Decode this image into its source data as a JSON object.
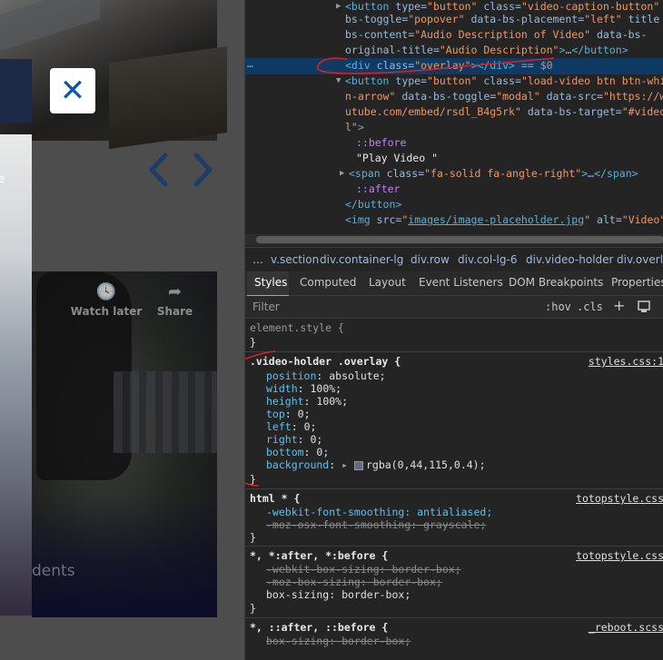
{
  "page": {
    "close_icon": "close-icon",
    "close_symbol": "✕",
    "prev_icon": "chevron-left-icon",
    "next_icon": "chevron-right-icon",
    "left_photo_label": "e",
    "watch_later_label": "Watch later",
    "share_label": "Share",
    "students_text": "dents"
  },
  "elements": {
    "lines": [
      {
        "prefix": "▶",
        "html": "<span class=\"tag\">&lt;button</span> <span class=\"attr\">type</span>=<span class=\"val\">\"button\"</span> <span class=\"attr\">class</span>=<span class=\"val\">\"video-caption-button\"</span> <span class=\"attr\">da</span>"
      },
      {
        "html": "<span class=\"attr\">bs-toggle</span>=<span class=\"val\">\"popover\"</span> <span class=\"attr\">data-bs-placement</span>=<span class=\"val\">\"left\"</span> <span class=\"attr\">title</span> <span class=\"attr\">da</span>"
      },
      {
        "html": "<span class=\"attr\">bs-content</span>=<span class=\"val\">\"Audio Description of Video\"</span> <span class=\"attr\">data-bs-</span>"
      },
      {
        "html": "<span class=\"attr\">original-title</span>=<span class=\"val\">\"Audio Description\"</span><span class=\"tag\">&gt;</span>…<span class=\"tag\">&lt;/button&gt;</span>"
      },
      {
        "html": "<span class=\"tag\">&lt;div</span> <span class=\"attr\">class</span>=<span class=\"val\">\"overlay\"</span><span class=\"tag\">&gt;&lt;/div&gt;</span> <span class=\"dim\">== $0</span>"
      },
      {
        "prefix": "▼",
        "html": "<span class=\"tag\">&lt;button</span> <span class=\"attr\">type</span>=<span class=\"val\">\"button\"</span> <span class=\"attr\">class</span>=<span class=\"val\">\"load-video btn btn-white</span>"
      },
      {
        "html": "<span class=\"val\">n-arrow\"</span> <span class=\"attr\">data-bs-toggle</span>=<span class=\"val\">\"modal\"</span> <span class=\"attr\">data-src</span>=<span class=\"val\">\"https://www</span>"
      },
      {
        "html": "<span class=\"val\">utube.com/embed/rsdl_B4g5rk\"</span> <span class=\"attr\">data-bs-target</span>=<span class=\"val\">\"#video-m</span>"
      },
      {
        "html": "<span class=\"val\">l\"</span><span class=\"tag\">&gt;</span>"
      },
      {
        "html": "<span class=\"pseudo\">::before</span>"
      },
      {
        "html": "<span class=\"txt\">\"Play Video \"</span>"
      },
      {
        "prefix": "▶",
        "html": "<span class=\"tag\">&lt;span</span> <span class=\"attr\">class</span>=<span class=\"val\">\"fa-solid fa-angle-right\"</span><span class=\"tag\">&gt;</span>…<span class=\"tag\">&lt;/span&gt;</span>"
      },
      {
        "html": "<span class=\"pseudo\">::after</span>"
      },
      {
        "html": "<span class=\"tag\">&lt;/button&gt;</span>"
      },
      {
        "html": "<span class=\"tag\">&lt;img</span> <span class=\"attr\">src</span>=<span class=\"val\">\"<span class=\"link\">images/image-placeholder.jpg</span>\"</span> <span class=\"attr\">alt</span>=<span class=\"val\">\"Video\"</span><span class=\"tag\">&gt;</span>"
      }
    ],
    "selected_dots": "…"
  },
  "breadcrumb": {
    "ellipsis": "…",
    "items": [
      "v.section",
      "div.container-lg",
      "div.row",
      "div.col-lg-6",
      "div.video-holder",
      "div.overlay"
    ]
  },
  "tabs": [
    "Styles",
    "Computed",
    "Layout",
    "Event Listeners",
    "DOM Breakpoints",
    "Properties"
  ],
  "filter": {
    "placeholder": "Filter",
    "hov": ":hov",
    "cls": ".cls",
    "plus": "+"
  },
  "styles": {
    "element_style": {
      "selector": "element.style {",
      "close": "}"
    },
    "overlay_rule": {
      "selector": ".video-holder .overlay {",
      "source": "styles.css:1",
      "props": [
        {
          "name": "position",
          "value": "absolute;"
        },
        {
          "name": "width",
          "value": "100%;"
        },
        {
          "name": "height",
          "value": "100%;"
        },
        {
          "name": "top",
          "value": "0;"
        },
        {
          "name": "left",
          "value": "0;"
        },
        {
          "name": "right",
          "value": "0;"
        },
        {
          "name": "bottom",
          "value": "0;"
        },
        {
          "name": "background",
          "value": "rgba(0,44,115,0.4);"
        }
      ],
      "close": "}"
    },
    "html_rule": {
      "selector": "html * {",
      "source": "totopstyle.css",
      "props": [
        {
          "text": "-webkit-font-smoothing: antialiased;",
          "struck": false
        },
        {
          "text": "-moz-osx-font-smoothing: grayscale;",
          "struck": true
        }
      ],
      "close": "}"
    },
    "box_rule_1": {
      "selector": "*, *:after, *:before {",
      "source": "totopstyle.css",
      "props": [
        {
          "text": "-webkit-box-sizing: border-box;",
          "struck": true
        },
        {
          "text": "-moz-box-sizing: border-box;",
          "struck": true
        },
        {
          "text": "box-sizing: border-box;",
          "struck": false
        }
      ],
      "close": "}"
    },
    "box_rule_2": {
      "selector": "*, ::after, ::before {",
      "source": "_reboot.scss",
      "props": [
        {
          "text": "box-sizing: border-box;",
          "struck": true
        }
      ]
    }
  },
  "colors": {
    "overlay_swatch": "rgba(0,44,115,0.4)",
    "annotation": "#e0201e",
    "selection_bg": "#0f3a63"
  }
}
